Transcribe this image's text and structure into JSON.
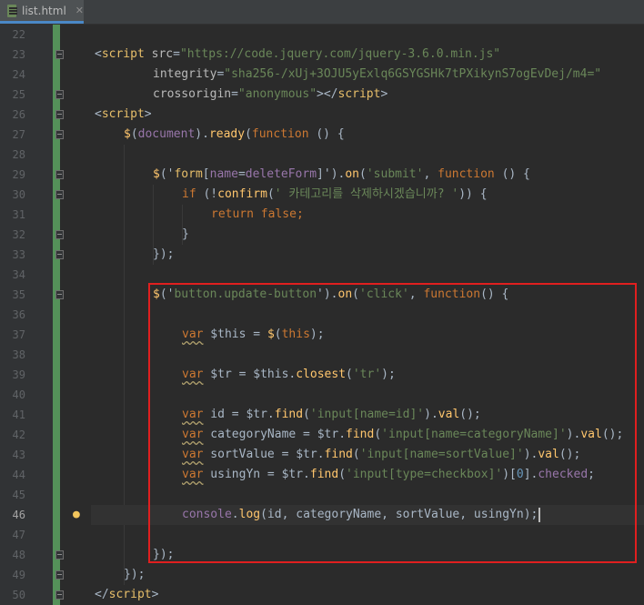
{
  "tab": {
    "filename": "list.html",
    "close": "✕",
    "icon": "html-file-icon"
  },
  "highlight": {
    "color": "#e01f1f"
  },
  "lines": [
    {
      "n": "22",
      "tokens": []
    },
    {
      "n": "23",
      "tokens": [
        {
          "t": "<",
          "c": "ph"
        },
        {
          "t": "script",
          "c": "tag"
        },
        {
          "t": " ",
          "c": "ph"
        },
        {
          "t": "src",
          "c": "attr"
        },
        {
          "t": "=",
          "c": "ph"
        },
        {
          "t": "\"https://code.jquery.com/jquery-3.6.0.min.js\"",
          "c": "str"
        }
      ],
      "indent": 0
    },
    {
      "n": "24",
      "tokens": [
        {
          "t": "integrity",
          "c": "attr"
        },
        {
          "t": "=",
          "c": "ph"
        },
        {
          "t": "\"sha256-/xUj+3OJU5yExlq6GSYGSHk7tPXikynS7ogEvDej/m4=\"",
          "c": "str"
        }
      ],
      "indent": 8
    },
    {
      "n": "25",
      "tokens": [
        {
          "t": "crossorigin",
          "c": "attr"
        },
        {
          "t": "=",
          "c": "ph"
        },
        {
          "t": "\"anonymous\"",
          "c": "str"
        },
        {
          "t": "></",
          "c": "ph"
        },
        {
          "t": "script",
          "c": "tag"
        },
        {
          "t": ">",
          "c": "ph"
        }
      ],
      "indent": 8
    },
    {
      "n": "26",
      "tokens": [
        {
          "t": "<",
          "c": "ph"
        },
        {
          "t": "script",
          "c": "tag"
        },
        {
          "t": ">",
          "c": "ph"
        }
      ],
      "indent": 0
    },
    {
      "n": "27",
      "tokens": [
        {
          "t": "$",
          "c": "fn"
        },
        {
          "t": "(",
          "c": "ph"
        },
        {
          "t": "document",
          "c": "prop"
        },
        {
          "t": ").",
          "c": "ph"
        },
        {
          "t": "ready",
          "c": "fn"
        },
        {
          "t": "(",
          "c": "ph"
        },
        {
          "t": "function",
          "c": "kw"
        },
        {
          "t": " () {",
          "c": "ph"
        }
      ],
      "indent": 4
    },
    {
      "n": "28",
      "tokens": []
    },
    {
      "n": "29",
      "tokens": [
        {
          "t": "$",
          "c": "fn"
        },
        {
          "t": "('",
          "c": "ph"
        },
        {
          "t": "form",
          "c": "tag"
        },
        {
          "t": "[",
          "c": "ph"
        },
        {
          "t": "name",
          "c": "prop"
        },
        {
          "t": "=",
          "c": "ph"
        },
        {
          "t": "deleteForm",
          "c": "prop"
        },
        {
          "t": "]",
          "c": "ph"
        },
        {
          "t": "').",
          "c": "ph"
        },
        {
          "t": "on",
          "c": "fn"
        },
        {
          "t": "(",
          "c": "ph"
        },
        {
          "t": "'submit'",
          "c": "str"
        },
        {
          "t": ", ",
          "c": "ph"
        },
        {
          "t": "function",
          "c": "kw"
        },
        {
          "t": " () {",
          "c": "ph"
        }
      ],
      "indent": 8
    },
    {
      "n": "30",
      "tokens": [
        {
          "t": "if",
          "c": "kw"
        },
        {
          "t": " (!",
          "c": "ph"
        },
        {
          "t": "confirm",
          "c": "fn"
        },
        {
          "t": "(",
          "c": "ph"
        },
        {
          "t": "' 카테고리를 삭제하시겠습니까? '",
          "c": "str"
        },
        {
          "t": ")) {",
          "c": "ph"
        }
      ],
      "indent": 12
    },
    {
      "n": "31",
      "tokens": [
        {
          "t": "return",
          "c": "kw"
        },
        {
          "t": " ",
          "c": "ph"
        },
        {
          "t": "false",
          "c": "kw"
        },
        {
          "t": ";",
          "c": "kw"
        }
      ],
      "indent": 16
    },
    {
      "n": "32",
      "tokens": [
        {
          "t": "}",
          "c": "ph"
        }
      ],
      "indent": 12
    },
    {
      "n": "33",
      "tokens": [
        {
          "t": "});",
          "c": "ph"
        }
      ],
      "indent": 8
    },
    {
      "n": "34",
      "tokens": []
    },
    {
      "n": "35",
      "tokens": [
        {
          "t": "$",
          "c": "fn"
        },
        {
          "t": "('",
          "c": "ph"
        },
        {
          "t": "button.update-button",
          "c": "str"
        },
        {
          "t": "').",
          "c": "ph"
        },
        {
          "t": "on",
          "c": "fn"
        },
        {
          "t": "(",
          "c": "ph"
        },
        {
          "t": "'click'",
          "c": "str"
        },
        {
          "t": ", ",
          "c": "ph"
        },
        {
          "t": "function",
          "c": "kw"
        },
        {
          "t": "() {",
          "c": "ph"
        }
      ],
      "indent": 8
    },
    {
      "n": "36",
      "tokens": []
    },
    {
      "n": "37",
      "tokens": [
        {
          "t": "var",
          "c": "kw sq"
        },
        {
          "t": " $this = ",
          "c": "ph"
        },
        {
          "t": "$",
          "c": "fn"
        },
        {
          "t": "(",
          "c": "ph"
        },
        {
          "t": "this",
          "c": "kw"
        },
        {
          "t": ");",
          "c": "ph"
        }
      ],
      "indent": 12
    },
    {
      "n": "38",
      "tokens": []
    },
    {
      "n": "39",
      "tokens": [
        {
          "t": "var",
          "c": "kw sq"
        },
        {
          "t": " $tr = $this.",
          "c": "ph"
        },
        {
          "t": "closest",
          "c": "fn"
        },
        {
          "t": "(",
          "c": "ph"
        },
        {
          "t": "'tr'",
          "c": "str"
        },
        {
          "t": ");",
          "c": "ph"
        }
      ],
      "indent": 12
    },
    {
      "n": "40",
      "tokens": []
    },
    {
      "n": "41",
      "tokens": [
        {
          "t": "var",
          "c": "kw sq"
        },
        {
          "t": " id = $tr.",
          "c": "ph"
        },
        {
          "t": "find",
          "c": "fn"
        },
        {
          "t": "(",
          "c": "ph"
        },
        {
          "t": "'input[name=id]'",
          "c": "str"
        },
        {
          "t": ").",
          "c": "ph"
        },
        {
          "t": "val",
          "c": "fn"
        },
        {
          "t": "();",
          "c": "ph"
        }
      ],
      "indent": 12
    },
    {
      "n": "42",
      "tokens": [
        {
          "t": "var",
          "c": "kw sq"
        },
        {
          "t": " categoryName = $tr.",
          "c": "ph"
        },
        {
          "t": "find",
          "c": "fn"
        },
        {
          "t": "(",
          "c": "ph"
        },
        {
          "t": "'input[name=categoryName]'",
          "c": "str"
        },
        {
          "t": ").",
          "c": "ph"
        },
        {
          "t": "val",
          "c": "fn"
        },
        {
          "t": "();",
          "c": "ph"
        }
      ],
      "indent": 12
    },
    {
      "n": "43",
      "tokens": [
        {
          "t": "var",
          "c": "kw sq"
        },
        {
          "t": " sortValue = $tr.",
          "c": "ph"
        },
        {
          "t": "find",
          "c": "fn"
        },
        {
          "t": "(",
          "c": "ph"
        },
        {
          "t": "'input[name=sortValue]'",
          "c": "str"
        },
        {
          "t": ").",
          "c": "ph"
        },
        {
          "t": "val",
          "c": "fn"
        },
        {
          "t": "();",
          "c": "ph"
        }
      ],
      "indent": 12
    },
    {
      "n": "44",
      "tokens": [
        {
          "t": "var",
          "c": "kw sq"
        },
        {
          "t": " usingYn = $tr.",
          "c": "ph"
        },
        {
          "t": "find",
          "c": "fn"
        },
        {
          "t": "(",
          "c": "ph"
        },
        {
          "t": "'input[type=checkbox]'",
          "c": "str"
        },
        {
          "t": ")[",
          "c": "ph"
        },
        {
          "t": "0",
          "c": "num"
        },
        {
          "t": "].",
          "c": "ph"
        },
        {
          "t": "checked",
          "c": "prop"
        },
        {
          "t": ";",
          "c": "ph"
        }
      ],
      "indent": 12
    },
    {
      "n": "45",
      "tokens": []
    },
    {
      "n": "46",
      "tokens": [
        {
          "t": "console",
          "c": "prop"
        },
        {
          "t": ".",
          "c": "ph"
        },
        {
          "t": "log",
          "c": "fn"
        },
        {
          "t": "(id, categoryName, sortValue, usingYn);",
          "c": "ph"
        }
      ],
      "indent": 12,
      "current": true
    },
    {
      "n": "47",
      "tokens": []
    },
    {
      "n": "48",
      "tokens": [
        {
          "t": "});",
          "c": "ph"
        }
      ],
      "indent": 8
    },
    {
      "n": "49",
      "tokens": [
        {
          "t": "});",
          "c": "ph"
        }
      ],
      "indent": 4
    },
    {
      "n": "50",
      "tokens": [
        {
          "t": "</",
          "c": "ph"
        },
        {
          "t": "script",
          "c": "tag"
        },
        {
          "t": ">",
          "c": "ph"
        }
      ],
      "indent": 0
    }
  ]
}
